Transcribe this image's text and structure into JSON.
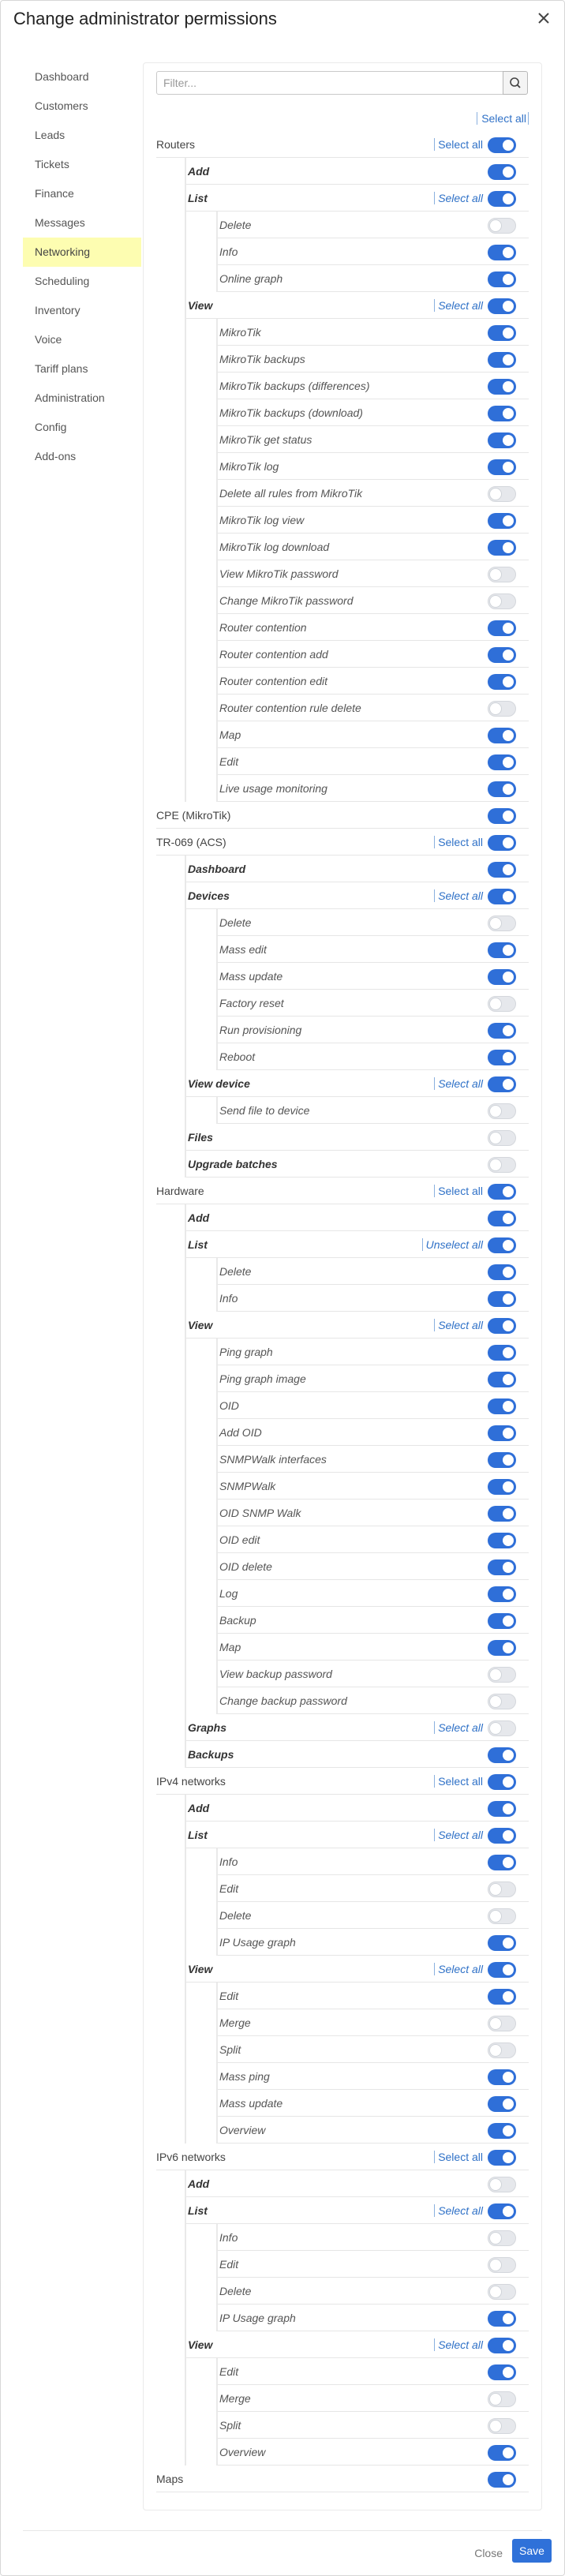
{
  "title": "Change administrator permissions",
  "sidebar": {
    "items": [
      {
        "label": "Dashboard",
        "active": false
      },
      {
        "label": "Customers",
        "active": false
      },
      {
        "label": "Leads",
        "active": false
      },
      {
        "label": "Tickets",
        "active": false
      },
      {
        "label": "Finance",
        "active": false
      },
      {
        "label": "Messages",
        "active": false
      },
      {
        "label": "Networking",
        "active": true
      },
      {
        "label": "Scheduling",
        "active": false
      },
      {
        "label": "Inventory",
        "active": false
      },
      {
        "label": "Voice",
        "active": false
      },
      {
        "label": "Tariff plans",
        "active": false
      },
      {
        "label": "Administration",
        "active": false
      },
      {
        "label": "Config",
        "active": false
      },
      {
        "label": "Add-ons",
        "active": false
      }
    ]
  },
  "filter": {
    "placeholder": "Filter...",
    "value": ""
  },
  "global_select_all": "Select all",
  "permissions": [
    {
      "label": "Routers",
      "level": 1,
      "on": true,
      "link": "Select all"
    },
    {
      "label": "Add",
      "level": 2,
      "on": true
    },
    {
      "label": "List",
      "level": 2,
      "on": true,
      "link": "Select all"
    },
    {
      "label": "Delete",
      "level": 3,
      "on": false
    },
    {
      "label": "Info",
      "level": 3,
      "on": true
    },
    {
      "label": "Online graph",
      "level": 3,
      "on": true
    },
    {
      "label": "View",
      "level": 2,
      "on": true,
      "link": "Select all"
    },
    {
      "label": "MikroTik",
      "level": 3,
      "on": true
    },
    {
      "label": "MikroTik backups",
      "level": 3,
      "on": true
    },
    {
      "label": "MikroTik backups (differences)",
      "level": 3,
      "on": true
    },
    {
      "label": "MikroTik backups (download)",
      "level": 3,
      "on": true
    },
    {
      "label": "MikroTik get status",
      "level": 3,
      "on": true
    },
    {
      "label": "MikroTik log",
      "level": 3,
      "on": true
    },
    {
      "label": "Delete all rules from MikroTik",
      "level": 3,
      "on": false
    },
    {
      "label": "MikroTik log view",
      "level": 3,
      "on": true
    },
    {
      "label": "MikroTik log download",
      "level": 3,
      "on": true
    },
    {
      "label": "View MikroTik password",
      "level": 3,
      "on": false
    },
    {
      "label": "Change MikroTik password",
      "level": 3,
      "on": false
    },
    {
      "label": "Router contention",
      "level": 3,
      "on": true
    },
    {
      "label": "Router contention add",
      "level": 3,
      "on": true
    },
    {
      "label": "Router contention edit",
      "level": 3,
      "on": true
    },
    {
      "label": "Router contention rule delete",
      "level": 3,
      "on": false
    },
    {
      "label": "Map",
      "level": 3,
      "on": true
    },
    {
      "label": "Edit",
      "level": 3,
      "on": true
    },
    {
      "label": "Live usage monitoring",
      "level": 3,
      "on": true
    },
    {
      "label": "CPE (MikroTik)",
      "level": 1,
      "on": true
    },
    {
      "label": "TR-069 (ACS)",
      "level": 1,
      "on": true,
      "link": "Select all"
    },
    {
      "label": "Dashboard",
      "level": 2,
      "on": true
    },
    {
      "label": "Devices",
      "level": 2,
      "on": true,
      "link": "Select all"
    },
    {
      "label": "Delete",
      "level": 3,
      "on": false
    },
    {
      "label": "Mass edit",
      "level": 3,
      "on": true
    },
    {
      "label": "Mass update",
      "level": 3,
      "on": true
    },
    {
      "label": "Factory reset",
      "level": 3,
      "on": false
    },
    {
      "label": "Run provisioning",
      "level": 3,
      "on": true
    },
    {
      "label": "Reboot",
      "level": 3,
      "on": true
    },
    {
      "label": "View device",
      "level": 2,
      "on": true,
      "link": "Select all"
    },
    {
      "label": "Send file to device",
      "level": 3,
      "on": false
    },
    {
      "label": "Files",
      "level": 2,
      "on": false
    },
    {
      "label": "Upgrade batches",
      "level": 2,
      "on": false
    },
    {
      "label": "Hardware",
      "level": 1,
      "on": true,
      "link": "Select all"
    },
    {
      "label": "Add",
      "level": 2,
      "on": true
    },
    {
      "label": "List",
      "level": 2,
      "on": true,
      "link": "Unselect all"
    },
    {
      "label": "Delete",
      "level": 3,
      "on": true
    },
    {
      "label": "Info",
      "level": 3,
      "on": true
    },
    {
      "label": "View",
      "level": 2,
      "on": true,
      "link": "Select all"
    },
    {
      "label": "Ping graph",
      "level": 3,
      "on": true
    },
    {
      "label": "Ping graph image",
      "level": 3,
      "on": true
    },
    {
      "label": "OID",
      "level": 3,
      "on": true
    },
    {
      "label": "Add OID",
      "level": 3,
      "on": true
    },
    {
      "label": "SNMPWalk interfaces",
      "level": 3,
      "on": true
    },
    {
      "label": "SNMPWalk",
      "level": 3,
      "on": true
    },
    {
      "label": "OID SNMP Walk",
      "level": 3,
      "on": true
    },
    {
      "label": "OID edit",
      "level": 3,
      "on": true
    },
    {
      "label": "OID delete",
      "level": 3,
      "on": true
    },
    {
      "label": "Log",
      "level": 3,
      "on": true
    },
    {
      "label": "Backup",
      "level": 3,
      "on": true
    },
    {
      "label": "Map",
      "level": 3,
      "on": true
    },
    {
      "label": "View backup password",
      "level": 3,
      "on": false
    },
    {
      "label": "Change backup password",
      "level": 3,
      "on": false
    },
    {
      "label": "Graphs",
      "level": 2,
      "on": false,
      "link": "Select all"
    },
    {
      "label": "Backups",
      "level": 2,
      "on": true
    },
    {
      "label": "IPv4 networks",
      "level": 1,
      "on": true,
      "link": "Select all"
    },
    {
      "label": "Add",
      "level": 2,
      "on": true
    },
    {
      "label": "List",
      "level": 2,
      "on": true,
      "link": "Select all"
    },
    {
      "label": "Info",
      "level": 3,
      "on": true
    },
    {
      "label": "Edit",
      "level": 3,
      "on": false
    },
    {
      "label": "Delete",
      "level": 3,
      "on": false
    },
    {
      "label": "IP Usage graph",
      "level": 3,
      "on": true
    },
    {
      "label": "View",
      "level": 2,
      "on": true,
      "link": "Select all"
    },
    {
      "label": "Edit",
      "level": 3,
      "on": true
    },
    {
      "label": "Merge",
      "level": 3,
      "on": false
    },
    {
      "label": "Split",
      "level": 3,
      "on": false
    },
    {
      "label": "Mass ping",
      "level": 3,
      "on": true
    },
    {
      "label": "Mass update",
      "level": 3,
      "on": true
    },
    {
      "label": "Overview",
      "level": 3,
      "on": true
    },
    {
      "label": "IPv6 networks",
      "level": 1,
      "on": true,
      "link": "Select all"
    },
    {
      "label": "Add",
      "level": 2,
      "on": false
    },
    {
      "label": "List",
      "level": 2,
      "on": true,
      "link": "Select all"
    },
    {
      "label": "Info",
      "level": 3,
      "on": false
    },
    {
      "label": "Edit",
      "level": 3,
      "on": false
    },
    {
      "label": "Delete",
      "level": 3,
      "on": false
    },
    {
      "label": "IP Usage graph",
      "level": 3,
      "on": true
    },
    {
      "label": "View",
      "level": 2,
      "on": true,
      "link": "Select all"
    },
    {
      "label": "Edit",
      "level": 3,
      "on": true
    },
    {
      "label": "Merge",
      "level": 3,
      "on": false
    },
    {
      "label": "Split",
      "level": 3,
      "on": false
    },
    {
      "label": "Overview",
      "level": 3,
      "on": true
    },
    {
      "label": "Maps",
      "level": 1,
      "on": true
    }
  ],
  "footer": {
    "close_label": "Close",
    "save_label": "Save"
  },
  "colors": {
    "accent": "#2f6fd8",
    "active_nav": "#fdfdb1",
    "link": "#2f71c7"
  },
  "icons": {
    "close": "close-icon",
    "search": "search-icon"
  }
}
